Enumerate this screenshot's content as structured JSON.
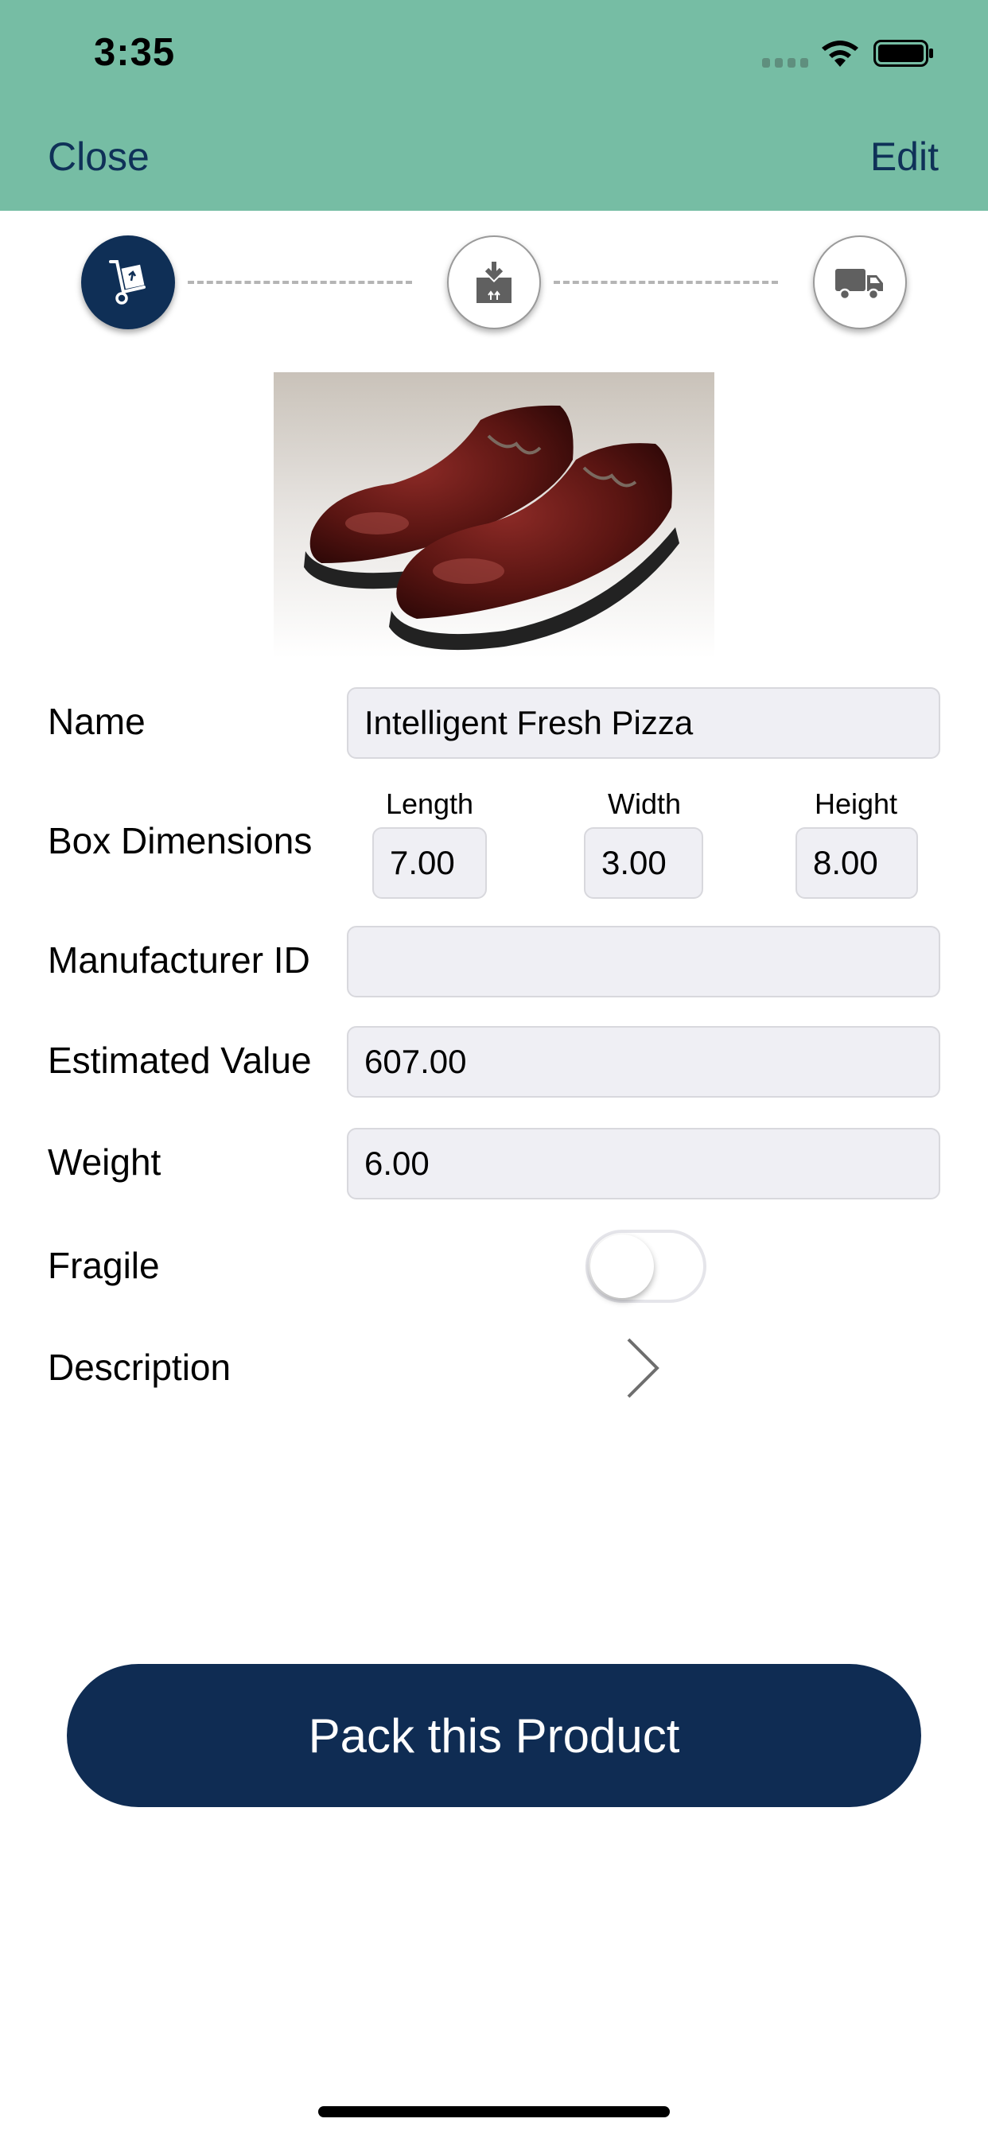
{
  "status_bar": {
    "time": "3:35"
  },
  "nav": {
    "close_label": "Close",
    "edit_label": "Edit"
  },
  "stepper": {
    "steps": [
      {
        "icon": "hand-truck-icon",
        "state": "active"
      },
      {
        "icon": "box-download-icon",
        "state": "inactive"
      },
      {
        "icon": "truck-icon",
        "state": "inactive"
      }
    ]
  },
  "product": {
    "image_icon": "shoes-image",
    "name_label": "Name",
    "name_value": "Intelligent Fresh Pizza",
    "box_dimensions_label": "Box Dimensions",
    "length_label": "Length",
    "length_value": "7.00",
    "width_label": "Width",
    "width_value": "3.00",
    "height_label": "Height",
    "height_value": "8.00",
    "manufacturer_id_label": "Manufacturer ID",
    "manufacturer_id_value": "",
    "estimated_value_label": "Estimated Value",
    "estimated_value_value": "607.00",
    "weight_label": "Weight",
    "weight_value": "6.00",
    "fragile_label": "Fragile",
    "fragile_on": false,
    "description_label": "Description"
  },
  "action": {
    "pack_label": "Pack this Product"
  },
  "colors": {
    "header": "#76bda4",
    "nav_text": "#0f3158",
    "primary": "#0f2c53",
    "field_bg": "#efeff4"
  }
}
